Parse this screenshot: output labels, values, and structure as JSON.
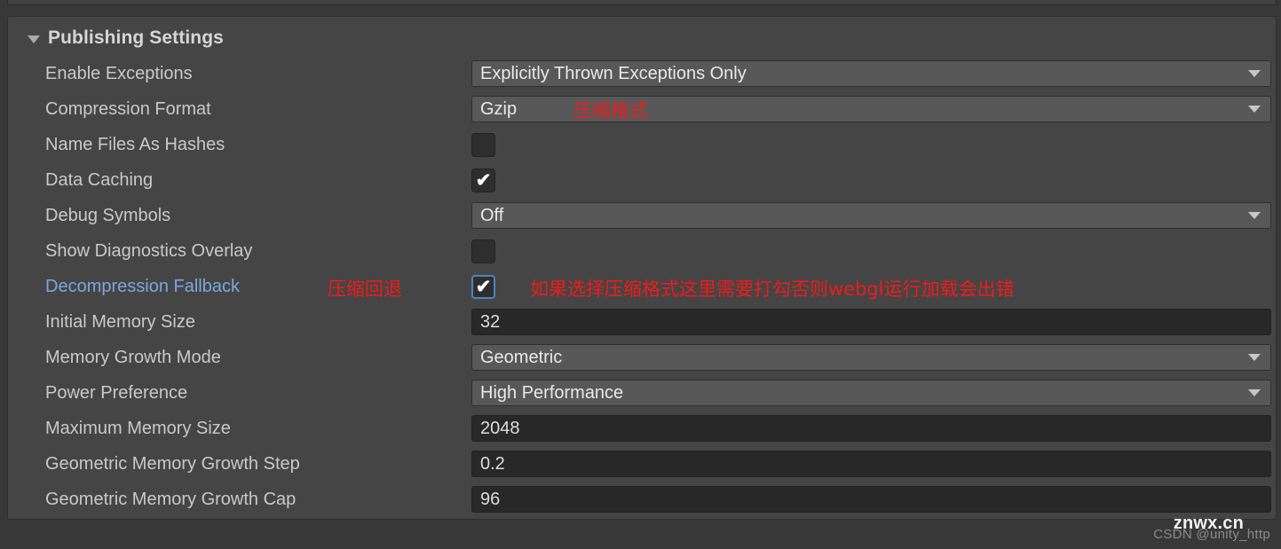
{
  "panel": {
    "header": "Publishing Settings",
    "foldout_icon": "triangle-down-icon"
  },
  "rows": [
    {
      "label": "Enable Exceptions",
      "type": "dropdown",
      "value": "Explicitly Thrown Exceptions Only"
    },
    {
      "label": "Compression Format",
      "type": "dropdown",
      "value": "Gzip"
    },
    {
      "label": "Name Files As Hashes",
      "type": "checkbox",
      "value": false
    },
    {
      "label": "Data Caching",
      "type": "checkbox",
      "value": true
    },
    {
      "label": "Debug Symbols",
      "type": "dropdown",
      "value": "Off"
    },
    {
      "label": "Show Diagnostics Overlay",
      "type": "checkbox",
      "value": false
    },
    {
      "label": "Decompression Fallback",
      "type": "checkbox",
      "value": true
    },
    {
      "label": "Initial Memory Size",
      "type": "textfield",
      "value": "32"
    },
    {
      "label": "Memory Growth Mode",
      "type": "dropdown",
      "value": "Geometric"
    },
    {
      "label": "Power Preference",
      "type": "dropdown",
      "value": "High Performance"
    },
    {
      "label": "Maximum Memory Size",
      "type": "textfield",
      "value": "2048"
    },
    {
      "label": "Geometric Memory Growth Step",
      "type": "textfield",
      "value": "0.2"
    },
    {
      "label": "Geometric Memory Growth Cap",
      "type": "textfield",
      "value": "96"
    }
  ],
  "annotations": {
    "compression_format": "压缩格式",
    "decompression_fallback_label": "压缩回退",
    "decompression_fallback_note": "如果选择压缩格式这里需要打勾否则webgl运行加载会出错"
  },
  "watermarks": {
    "csdn": "CSDN @unity_http",
    "znwx": "znwx.cn"
  },
  "colors": {
    "annotation_red": "#ef1b1b",
    "modified_label_blue": "#7ba7de",
    "focus_border_blue": "#4986c4",
    "panel_bg": "#454545",
    "window_bg": "#383838"
  },
  "glyphs": {
    "check": "✔"
  }
}
